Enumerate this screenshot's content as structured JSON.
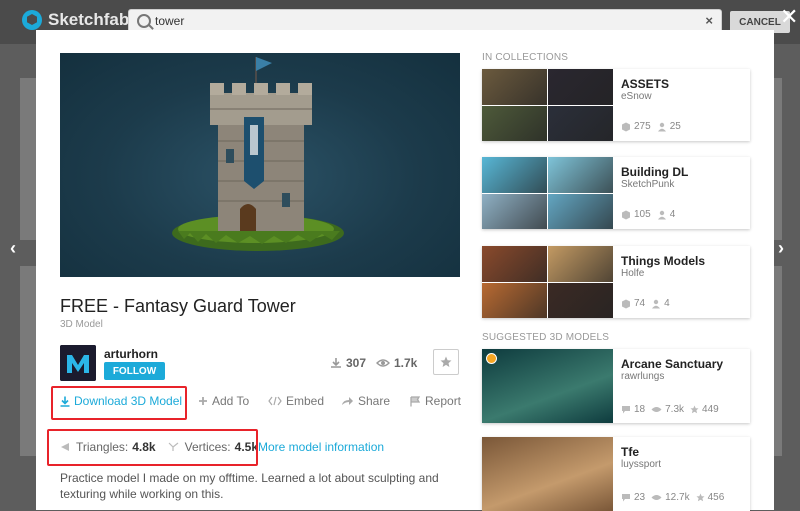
{
  "header": {
    "logo_text": "Sketchfab",
    "search_value": "tower",
    "cancel_label": "CANCEL",
    "clear_icon": "×",
    "close_icon": "✕"
  },
  "nav": {
    "prev_icon": "‹",
    "next_icon": "›"
  },
  "model": {
    "title": "FREE - Fantasy Guard Tower",
    "type": "3D Model",
    "author": "arturhorn",
    "follow_label": "FOLLOW",
    "downloads": "307",
    "views": "1.7k",
    "actions": {
      "download": "Download 3D Model",
      "add_to": "Add To",
      "embed": "Embed",
      "share": "Share",
      "report": "Report"
    },
    "triangles_label": "Triangles:",
    "triangles_value": "4.8k",
    "vertices_label": "Vertices:",
    "vertices_value": "4.5k",
    "more_info": "More model information",
    "description": "Practice model I made on my offtime. Learned a lot about sculpting and texturing while working on this."
  },
  "collections": {
    "heading": "IN COLLECTIONS",
    "items": [
      {
        "name": "ASSETS",
        "owner": "eSnow",
        "models": "275",
        "followers": "25",
        "colors": [
          "#6b5a3e",
          "#2a2730",
          "#4e5a3a",
          "#2b2f3a"
        ]
      },
      {
        "name": "Building DL",
        "owner": "SketchPunk",
        "models": "105",
        "followers": "4",
        "colors": [
          "#58b7d6",
          "#7fc4d9",
          "#8fb0c4",
          "#63a6c2"
        ]
      },
      {
        "name": "Things Models",
        "owner": "Holfe",
        "models": "74",
        "followers": "4",
        "colors": [
          "#8a4a2c",
          "#c39a63",
          "#b86a32",
          "#3b2a24"
        ]
      }
    ]
  },
  "suggested": {
    "heading": "SUGGESTED 3D MODELS",
    "items": [
      {
        "name": "Arcane Sanctuary",
        "owner": "rawrlungs",
        "comments": "18",
        "views": "7.3k",
        "likes": "449",
        "colors": [
          "#0e3b3e",
          "#3b7a6e"
        ]
      },
      {
        "name": "Tfe",
        "owner": "luyssport",
        "comments": "23",
        "views": "12.7k",
        "likes": "456",
        "colors": [
          "#7a5738",
          "#c49a6c"
        ]
      }
    ]
  }
}
